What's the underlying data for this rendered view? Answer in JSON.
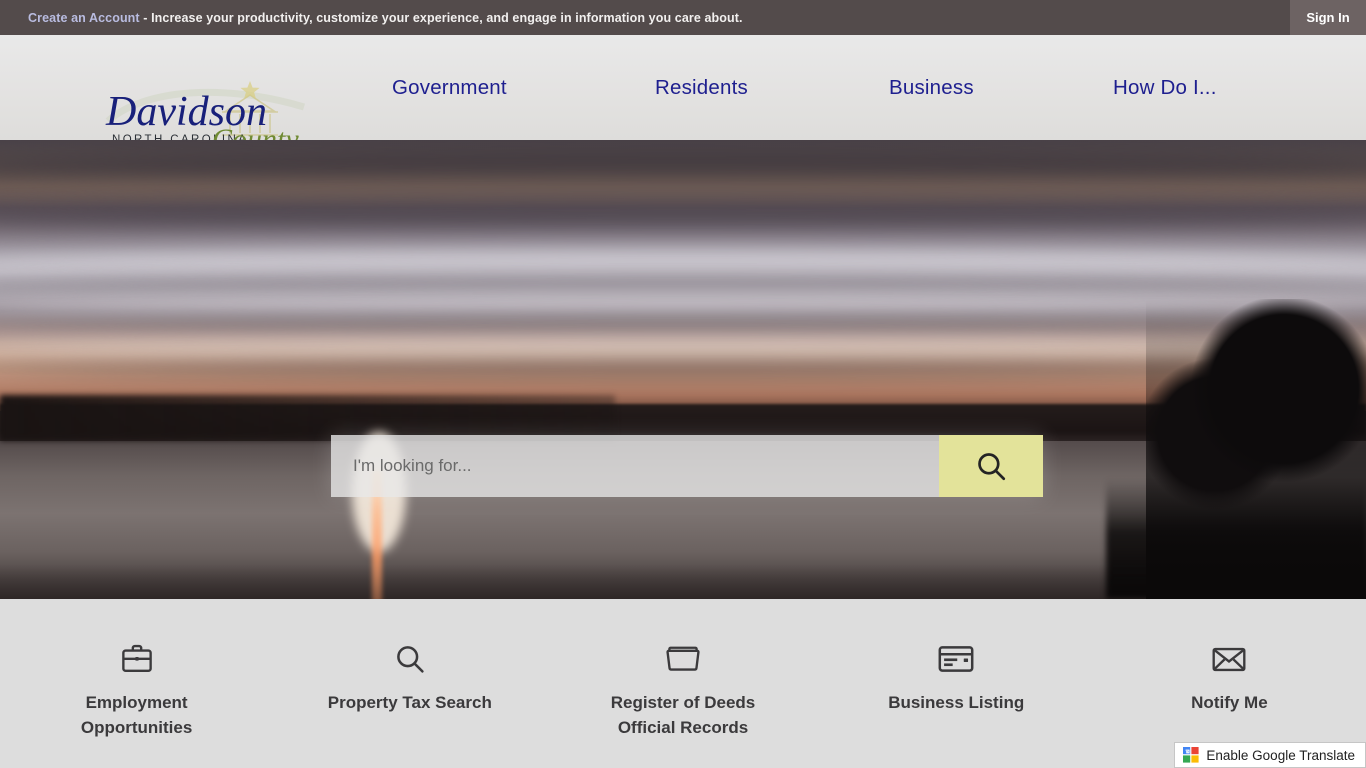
{
  "topbar": {
    "account_link": "Create an Account",
    "message": " - Increase your productivity, customize your experience, and engage in information you care about.",
    "signin_label": "Sign In"
  },
  "header": {
    "logo": {
      "name": "Davidson",
      "script": "County",
      "state": "NORTH CAROLINA",
      "icon": "courthouse-dome-icon"
    },
    "nav": [
      {
        "label": "Government"
      },
      {
        "label": "Residents"
      },
      {
        "label": "Business"
      },
      {
        "label": "How Do I..."
      }
    ]
  },
  "hero": {
    "alt": "Sunset over lake with boats and city lights",
    "search": {
      "placeholder": "I'm looking for...",
      "value": "",
      "button_icon": "search-icon",
      "button_color": "#e3e39a"
    }
  },
  "quicklinks": [
    {
      "label": "Employment Opportunities",
      "icon": "briefcase-icon"
    },
    {
      "label": "Property Tax Search",
      "icon": "search-icon"
    },
    {
      "label": "Register of Deeds Official Records",
      "icon": "folder-icon"
    },
    {
      "label": "Business Listing",
      "icon": "card-icon"
    },
    {
      "label": "Notify Me",
      "icon": "envelope-icon"
    }
  ],
  "translate": {
    "label": "Enable Google Translate",
    "icon": "google-logo-icon"
  },
  "colors": {
    "topbar_bg": "#534b4b",
    "signin_bg": "#6d6363",
    "account_link": "#b9bce0",
    "nav_text": "#1e1f8f",
    "header_bg": "#e4e3e2",
    "quicklinks_bg": "#dddddd",
    "quicklink_text": "#3b3a3c",
    "search_button": "#e3e39a"
  }
}
